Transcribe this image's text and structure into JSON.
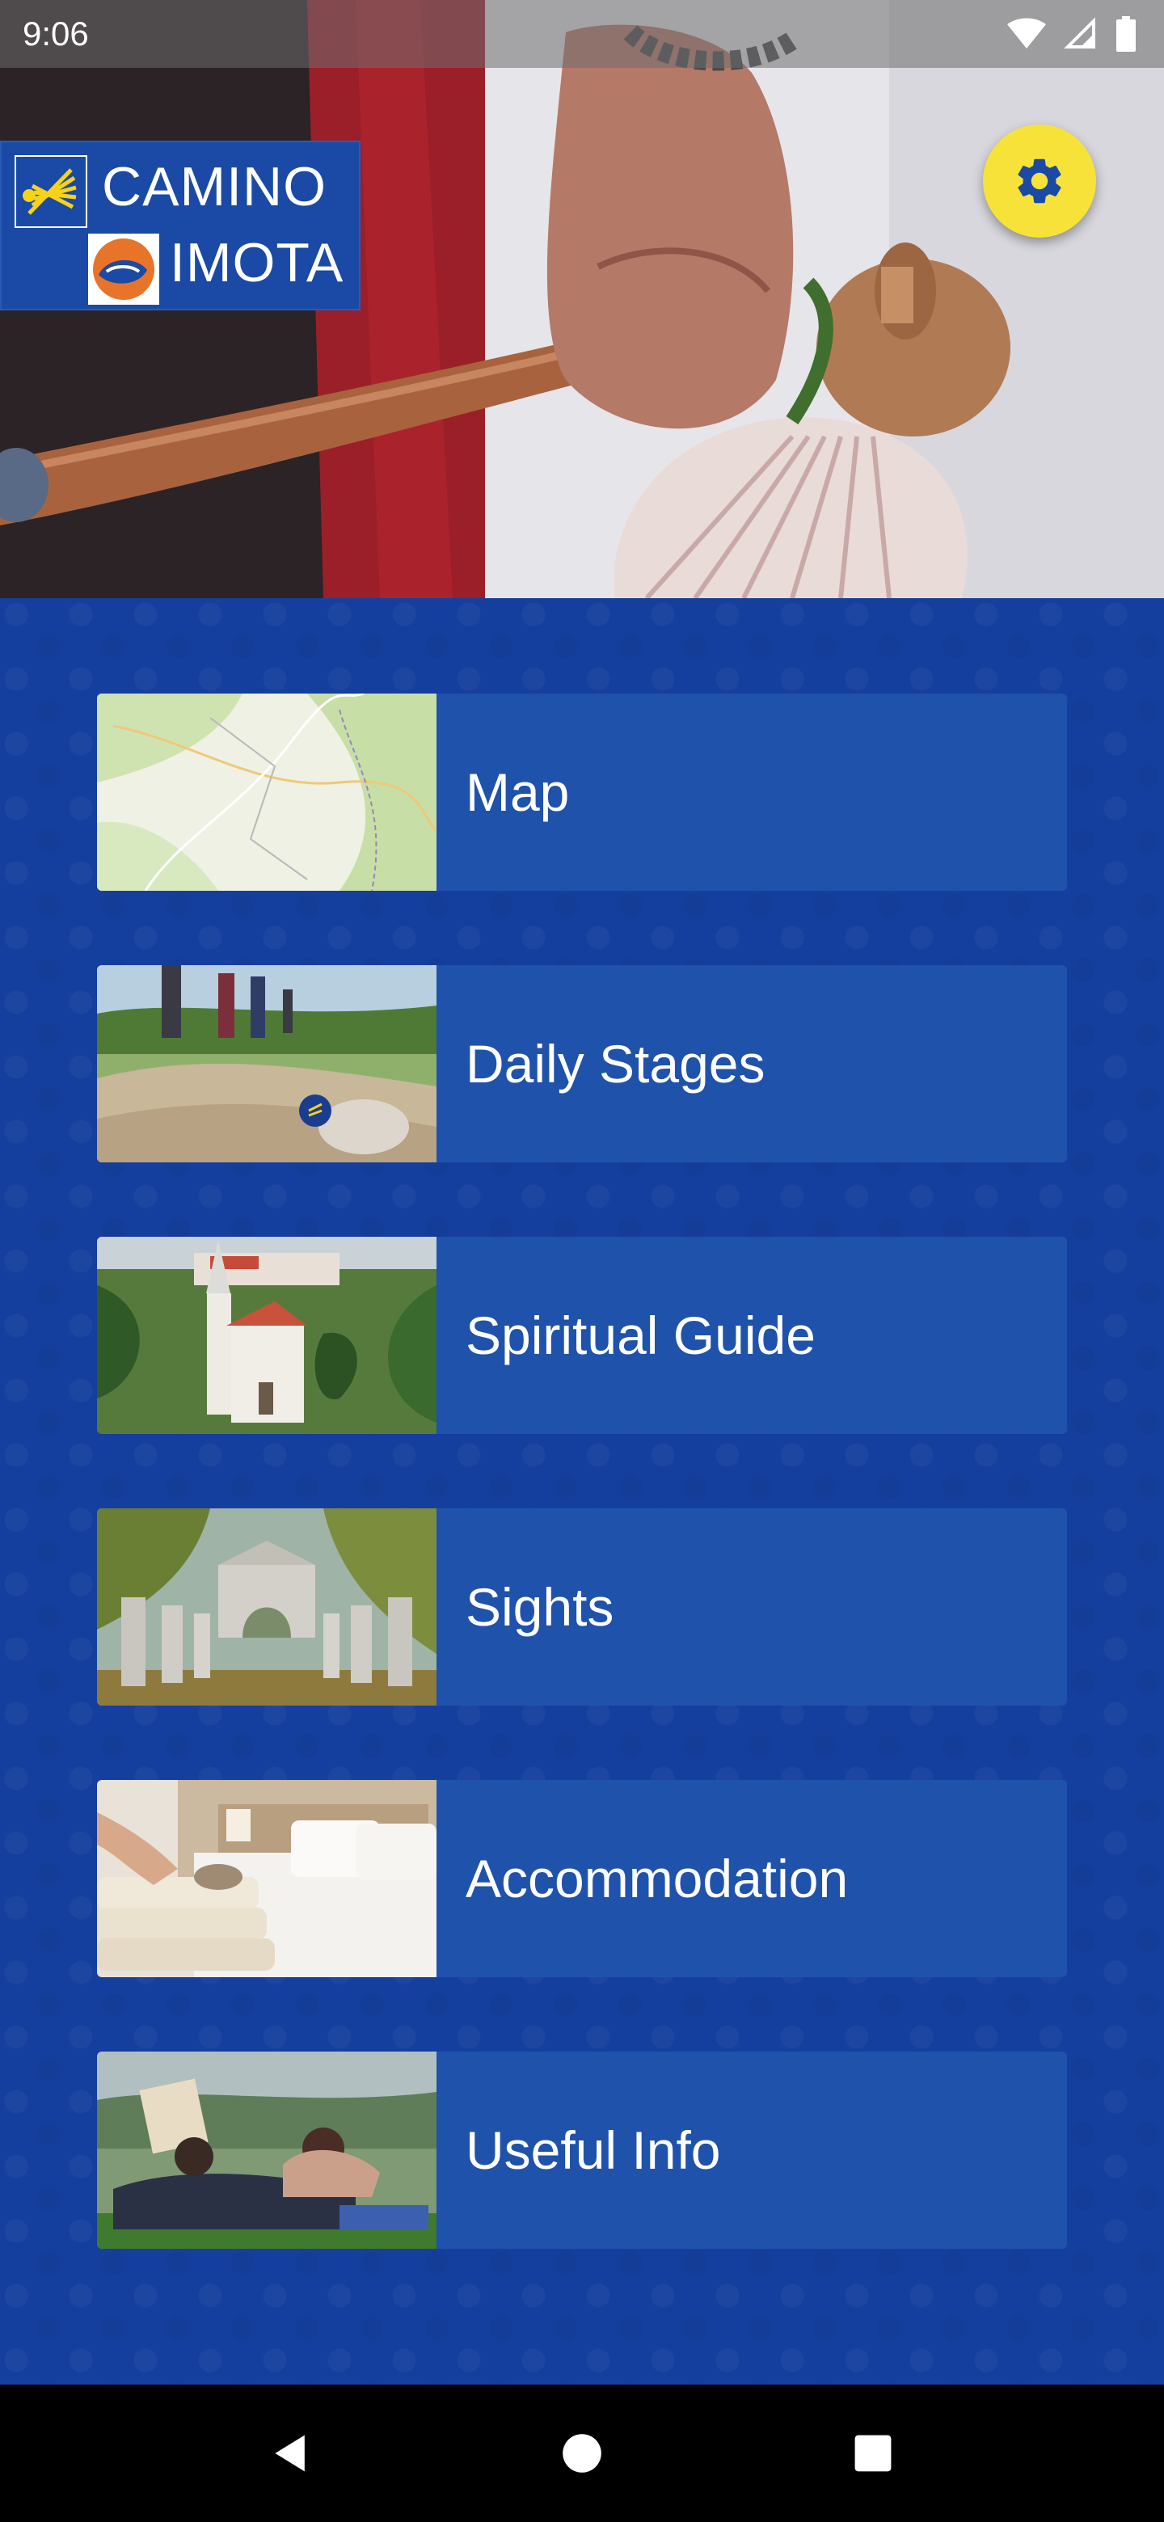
{
  "status_bar": {
    "time": "9:06",
    "icons": [
      "wifi-icon",
      "signal-icon",
      "battery-icon"
    ]
  },
  "header": {
    "logo_line1": "CAMINO",
    "logo_line2": "IMOTA",
    "logo_icons": [
      "scallop-shell-icon",
      "shell-emblem-icon"
    ],
    "settings_icon": "gear-icon"
  },
  "menu": [
    {
      "label": "Map",
      "thumb": "map-thumbnail"
    },
    {
      "label": "Daily Stages",
      "thumb": "hikers-thumbnail"
    },
    {
      "label": "Spiritual Guide",
      "thumb": "church-thumbnail"
    },
    {
      "label": "Sights",
      "thumb": "monument-thumbnail"
    },
    {
      "label": "Accommodation",
      "thumb": "bedroom-thumbnail"
    },
    {
      "label": "Useful Info",
      "thumb": "picnic-thumbnail"
    }
  ],
  "nav_bar": {
    "icons": [
      "back-icon",
      "home-icon",
      "recents-icon"
    ]
  },
  "colors": {
    "background_blue": "#153f9e",
    "card_blue": "#1f52ab",
    "logo_blue": "#1a4aa5",
    "fab_yellow": "#f7e23a",
    "accent_orange": "#e8742a"
  }
}
